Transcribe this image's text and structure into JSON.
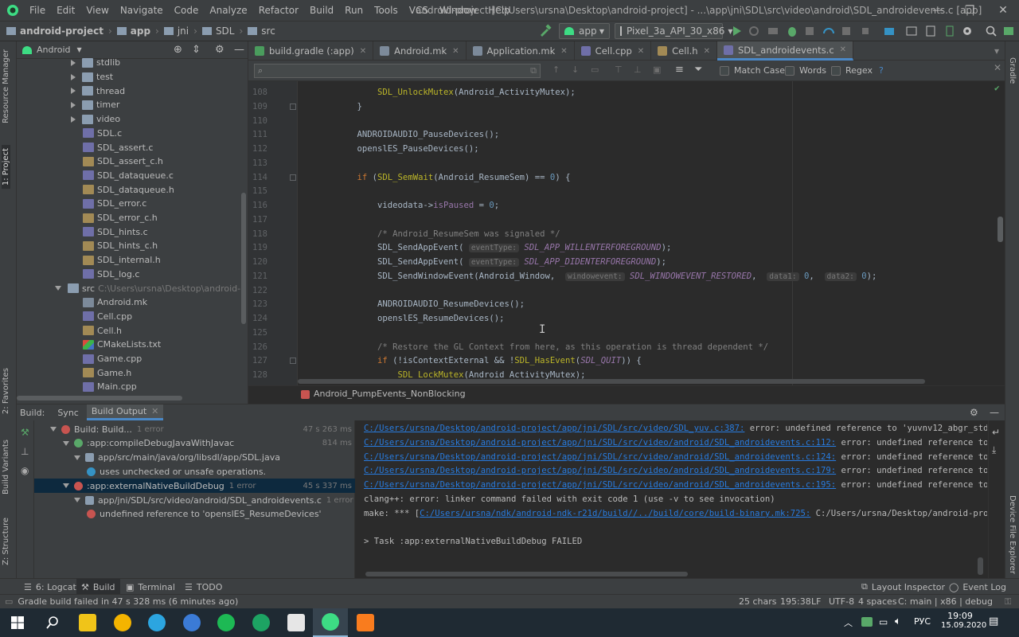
{
  "menu": [
    "File",
    "Edit",
    "View",
    "Navigate",
    "Code",
    "Analyze",
    "Refactor",
    "Build",
    "Run",
    "Tools",
    "VCS",
    "Window",
    "Help"
  ],
  "window_title": "android-project [C:\\Users\\ursna\\Desktop\\android-project] - ...\\app\\jni\\SDL\\src\\video\\android\\SDL_androidevents.c [app]",
  "nav": {
    "crumbs": [
      "android-project",
      "app",
      "jni",
      "SDL",
      "src"
    ],
    "run_config": "app",
    "device": "Pixel_3a_API_30_x86"
  },
  "project": {
    "view_mode": "Android",
    "tree": [
      {
        "label": "stdlib",
        "kind": "folder",
        "depth": 1
      },
      {
        "label": "test",
        "kind": "folder",
        "depth": 1
      },
      {
        "label": "thread",
        "kind": "folder",
        "depth": 1
      },
      {
        "label": "timer",
        "kind": "folder",
        "depth": 1
      },
      {
        "label": "video",
        "kind": "folder",
        "depth": 1
      },
      {
        "label": "SDL.c",
        "kind": "c",
        "depth": 2
      },
      {
        "label": "SDL_assert.c",
        "kind": "c",
        "depth": 2
      },
      {
        "label": "SDL_assert_c.h",
        "kind": "h",
        "depth": 2
      },
      {
        "label": "SDL_dataqueue.c",
        "kind": "c",
        "depth": 2
      },
      {
        "label": "SDL_dataqueue.h",
        "kind": "h",
        "depth": 2
      },
      {
        "label": "SDL_error.c",
        "kind": "c",
        "depth": 2
      },
      {
        "label": "SDL_error_c.h",
        "kind": "h",
        "depth": 2
      },
      {
        "label": "SDL_hints.c",
        "kind": "c",
        "depth": 2
      },
      {
        "label": "SDL_hints_c.h",
        "kind": "h",
        "depth": 2
      },
      {
        "label": "SDL_internal.h",
        "kind": "h",
        "depth": 2
      },
      {
        "label": "SDL_log.c",
        "kind": "c",
        "depth": 2
      },
      {
        "label": "src",
        "kind": "folder-open",
        "depth": 0,
        "path": "C:\\Users\\ursna\\Desktop\\android-project"
      },
      {
        "label": "Android.mk",
        "kind": "mk",
        "depth": 2
      },
      {
        "label": "Cell.cpp",
        "kind": "c",
        "depth": 2
      },
      {
        "label": "Cell.h",
        "kind": "h",
        "depth": 2
      },
      {
        "label": "CMakeLists.txt",
        "kind": "cmake",
        "depth": 2
      },
      {
        "label": "Game.cpp",
        "kind": "c",
        "depth": 2
      },
      {
        "label": "Game.h",
        "kind": "h",
        "depth": 2
      },
      {
        "label": "Main.cpp",
        "kind": "c",
        "depth": 2
      }
    ]
  },
  "tabs": [
    {
      "label": "build.gradle (:app)",
      "color": "#4a9c5d"
    },
    {
      "label": "Android.mk",
      "color": "#7c8a9a"
    },
    {
      "label": "Application.mk",
      "color": "#7c8a9a"
    },
    {
      "label": "Cell.cpp",
      "color": "#6f6fa8"
    },
    {
      "label": "Cell.h",
      "color": "#a28a55"
    },
    {
      "label": "SDL_androidevents.c",
      "color": "#6f6fa8",
      "active": true
    }
  ],
  "find": {
    "match_case": "Match Case",
    "words": "Words",
    "regex": "Regex",
    "help": "?"
  },
  "code_lines": [
    {
      "n": "108",
      "html": "        <span class='f'>SDL_UnlockMutex</span>(Android_ActivityMutex);"
    },
    {
      "n": "109",
      "html": "    }"
    },
    {
      "n": "110",
      "html": ""
    },
    {
      "n": "111",
      "html": "    ANDROIDAUDIO_PauseDevices();"
    },
    {
      "n": "112",
      "html": "    openslES_PauseDevices();"
    },
    {
      "n": "113",
      "html": ""
    },
    {
      "n": "114",
      "html": "    <span class='k'>if</span> (<span class='f'>SDL_SemWait</span>(Android_ResumeSem) == <span class='n'>0</span>) {"
    },
    {
      "n": "115",
      "html": ""
    },
    {
      "n": "116",
      "html": "        videodata-><span class='p'>isPaused</span> = <span class='n'>0</span>;"
    },
    {
      "n": "117",
      "html": ""
    },
    {
      "n": "118",
      "html": "        <span class='c'>/* Android_ResumeSem was signaled */</span>"
    },
    {
      "n": "119",
      "html": "        SDL_SendAppEvent( <span class='hint'>eventType:</span> <span class='it'>SDL_APP_WILLENTERFOREGROUND</span>);"
    },
    {
      "n": "120",
      "html": "        SDL_SendAppEvent( <span class='hint'>eventType:</span> <span class='it'>SDL_APP_DIDENTERFOREGROUND</span>);"
    },
    {
      "n": "121",
      "html": "        SDL_SendWindowEvent(Android_Window,  <span class='hint'>windowevent:</span> <span class='it'>SDL_WINDOWEVENT_RESTORED</span>,  <span class='hint'>data1:</span> <span class='n'>0</span>,  <span class='hint'>data2:</span> <span class='n'>0</span>);"
    },
    {
      "n": "122",
      "html": ""
    },
    {
      "n": "123",
      "html": "        ANDROIDAUDIO_ResumeDevices();"
    },
    {
      "n": "124",
      "html": "        openslES_ResumeDevices();"
    },
    {
      "n": "125",
      "html": ""
    },
    {
      "n": "126",
      "html": "        <span class='c'>/* Restore the GL Context from here, as this operation is thread dependent */</span>"
    },
    {
      "n": "127",
      "html": "        <span class='k'>if</span> (!isContextExternal && !<span class='f'>SDL_HasEvent</span>(<span class='it'>SDL_QUIT</span>)) {"
    },
    {
      "n": "128",
      "html": "            <span class='f'>SDL_LockMutex</span>(Android_ActivityMutex);"
    }
  ],
  "function_breadcrumb": "Android_PumpEvents_NonBlocking",
  "build": {
    "header_tabs": [
      "Build:",
      "Sync",
      "Build Output"
    ],
    "tree": [
      {
        "label": "Build: Build...",
        "suffix": "1 error",
        "time": "47 s 263 ms",
        "icon": "err",
        "depth": 0
      },
      {
        "label": ":app:compileDebugJavaWithJavac",
        "suffix": "",
        "time": "814 ms",
        "icon": "ok",
        "depth": 1
      },
      {
        "label": "app/src/main/java/org/libsdl/app/SDL.java",
        "suffix": "",
        "time": "",
        "icon": "file",
        "depth": 2
      },
      {
        "label": "uses unchecked or unsafe operations.",
        "suffix": "",
        "time": "",
        "icon": "info",
        "depth": 3
      },
      {
        "label": ":app:externalNativeBuildDebug",
        "suffix": "1 error",
        "time": "45 s 337 ms",
        "icon": "err",
        "depth": 1,
        "selected": true
      },
      {
        "label": "app/jni/SDL/src/video/android/SDL_androidevents.c",
        "suffix": "1 error",
        "time": "",
        "icon": "file",
        "depth": 2
      },
      {
        "label": "undefined reference to 'openslES_ResumeDevices'",
        "suffix": "",
        "time": "",
        "icon": "err",
        "depth": 3
      }
    ],
    "output": [
      {
        "link": "C:/Users/ursna/Desktop/android-project/app/jni/SDL/src/video/SDL_yuv.c:387:",
        "text": " error: undefined reference to 'yuvnv12_abgr_std'"
      },
      {
        "link": "C:/Users/ursna/Desktop/android-project/app/jni/SDL/src/video/android/SDL_androidevents.c:112:",
        "text": " error: undefined reference to 'o"
      },
      {
        "link": "C:/Users/ursna/Desktop/android-project/app/jni/SDL/src/video/android/SDL_androidevents.c:124:",
        "text": " error: undefined reference to 'o"
      },
      {
        "link": "C:/Users/ursna/Desktop/android-project/app/jni/SDL/src/video/android/SDL_androidevents.c:179:",
        "text": " error: undefined reference to 'o"
      },
      {
        "link": "C:/Users/ursna/Desktop/android-project/app/jni/SDL/src/video/android/SDL_androidevents.c:195:",
        "text": " error: undefined reference to 'o"
      },
      {
        "link": "",
        "text": "clang++: error: linker command failed with exit code 1 (use -v to see invocation)"
      },
      {
        "prefix": "make: *** [",
        "link": "C:/Users/ursna/ndk/android-ndk-r21d/build//../build/core/build-binary.mk:725:",
        "text": " C:/Users/ursna/Desktop/android-proje"
      },
      {
        "link": "",
        "text": ""
      },
      {
        "link": "",
        "text": "> Task :app:externalNativeBuildDebug FAILED"
      }
    ]
  },
  "left_strip": [
    "Resource Manager",
    "1: Project",
    "2: Favorites",
    "Build Variants",
    "Z: Structure"
  ],
  "right_strip": [
    "Gradle",
    "Device File Explorer"
  ],
  "bottom_tools": [
    "6: Logcat",
    "Build",
    "Terminal",
    "TODO"
  ],
  "bottom_right_tools": [
    "Layout Inspector",
    "Event Log"
  ],
  "status": {
    "message": "Gradle build failed in 47 s 328 ms (6 minutes ago)",
    "chars": "25 chars",
    "position": "195:38",
    "line_sep": "LF",
    "encoding": "UTF-8",
    "indent": "4 spaces",
    "context": "C: main | x86 | debug"
  },
  "taskbar": {
    "lang": "РУС",
    "time": "19:09",
    "date": "15.09.2020",
    "apps": [
      {
        "name": "file-explorer-icon",
        "color": "#f0c419"
      },
      {
        "name": "chrome-icon",
        "color": "#f4b400"
      },
      {
        "name": "telegram-icon",
        "color": "#2ca5e0"
      },
      {
        "name": "qbittorrent-icon",
        "color": "#3b7bd6"
      },
      {
        "name": "spotify-icon",
        "color": "#1db954"
      },
      {
        "name": "cpp-tool-icon",
        "color": "#1da363"
      },
      {
        "name": "7zip-icon",
        "color": "#e6e6e6"
      },
      {
        "name": "android-studio-icon",
        "color": "#3ddc84"
      },
      {
        "name": "sublime-icon",
        "color": "#f97c1e"
      }
    ]
  }
}
